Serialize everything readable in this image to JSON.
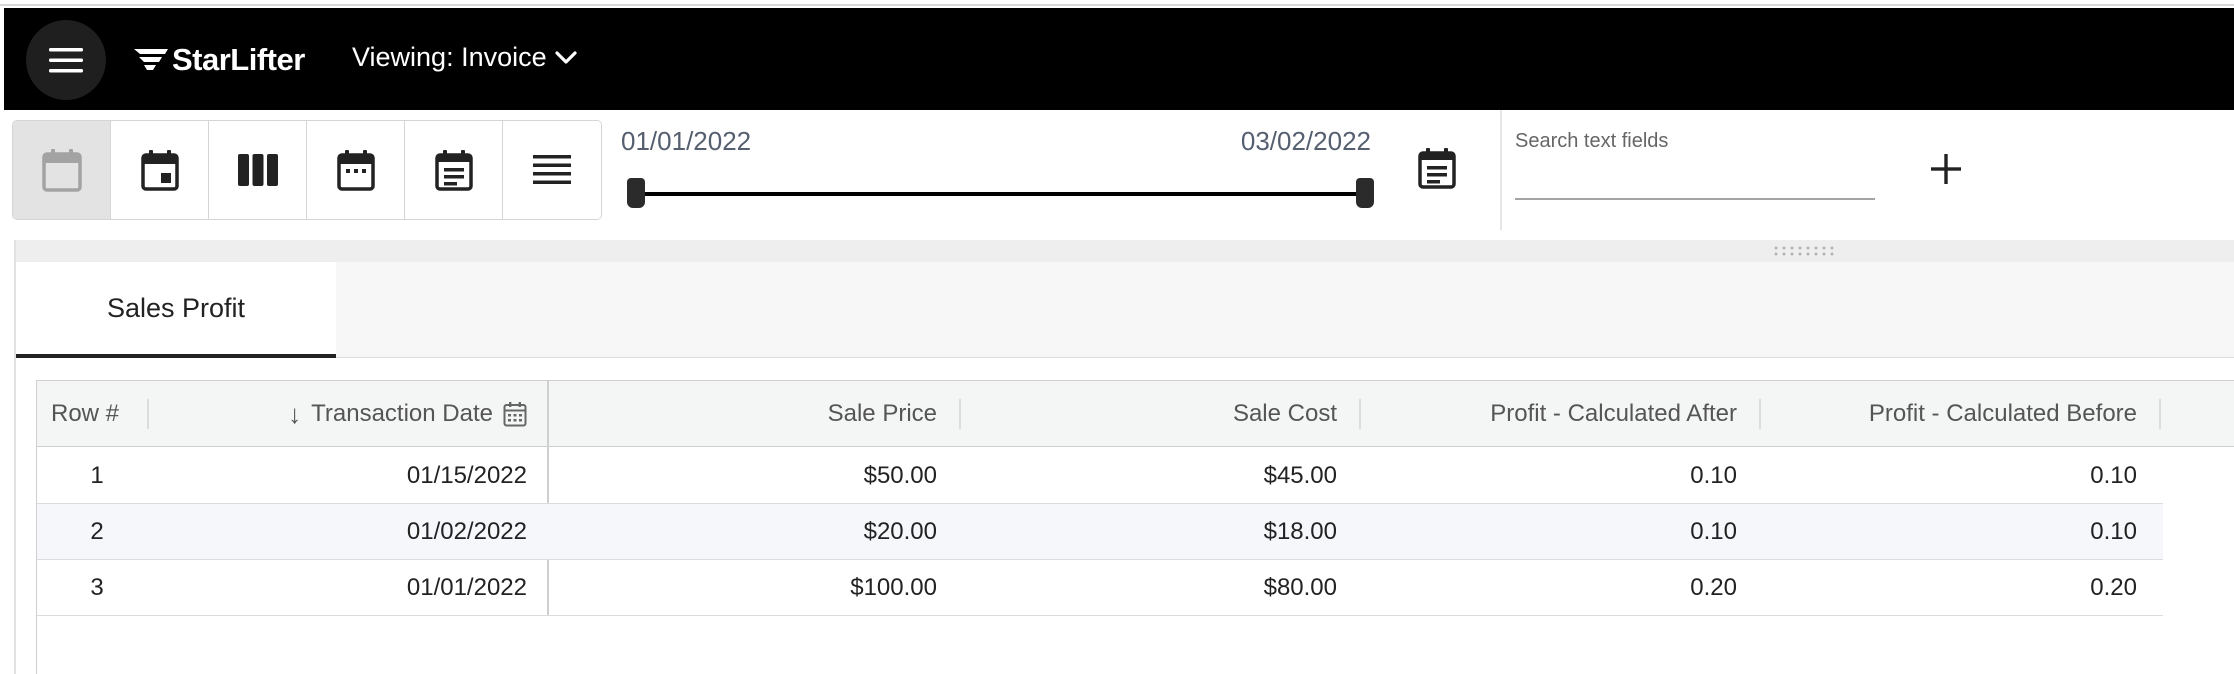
{
  "header": {
    "brand": "StarLifter",
    "viewing_label": "Viewing: Invoice"
  },
  "toolbar": {
    "view_buttons": [
      "calendar-blank",
      "calendar-day",
      "columns",
      "calendar-month",
      "calendar-agenda",
      "list"
    ],
    "date_start": "01/01/2022",
    "date_end": "03/02/2022",
    "search_placeholder": "Search text fields",
    "search_value": ""
  },
  "tabs": [
    {
      "label": "Sales Profit",
      "active": true
    }
  ],
  "grid": {
    "columns": [
      "Row #",
      "Transaction Date",
      "Sale Price",
      "Sale Cost",
      "Profit - Calculated After",
      "Profit - Calculated Before"
    ],
    "sort_indicator": "↓",
    "rows": [
      {
        "row": "1",
        "date": "01/15/2022",
        "price": "$50.00",
        "cost": "$45.00",
        "after": "0.10",
        "before": "0.10"
      },
      {
        "row": "2",
        "date": "01/02/2022",
        "price": "$20.00",
        "cost": "$18.00",
        "after": "0.10",
        "before": "0.10"
      },
      {
        "row": "3",
        "date": "01/01/2022",
        "price": "$100.00",
        "cost": "$80.00",
        "after": "0.20",
        "before": "0.20"
      }
    ]
  },
  "colors": {
    "header_bg": "#000000",
    "active_view_bg": "#e3e3e3",
    "alt_row_bg": "#f5f7fb",
    "date_text": "#555f6f"
  }
}
